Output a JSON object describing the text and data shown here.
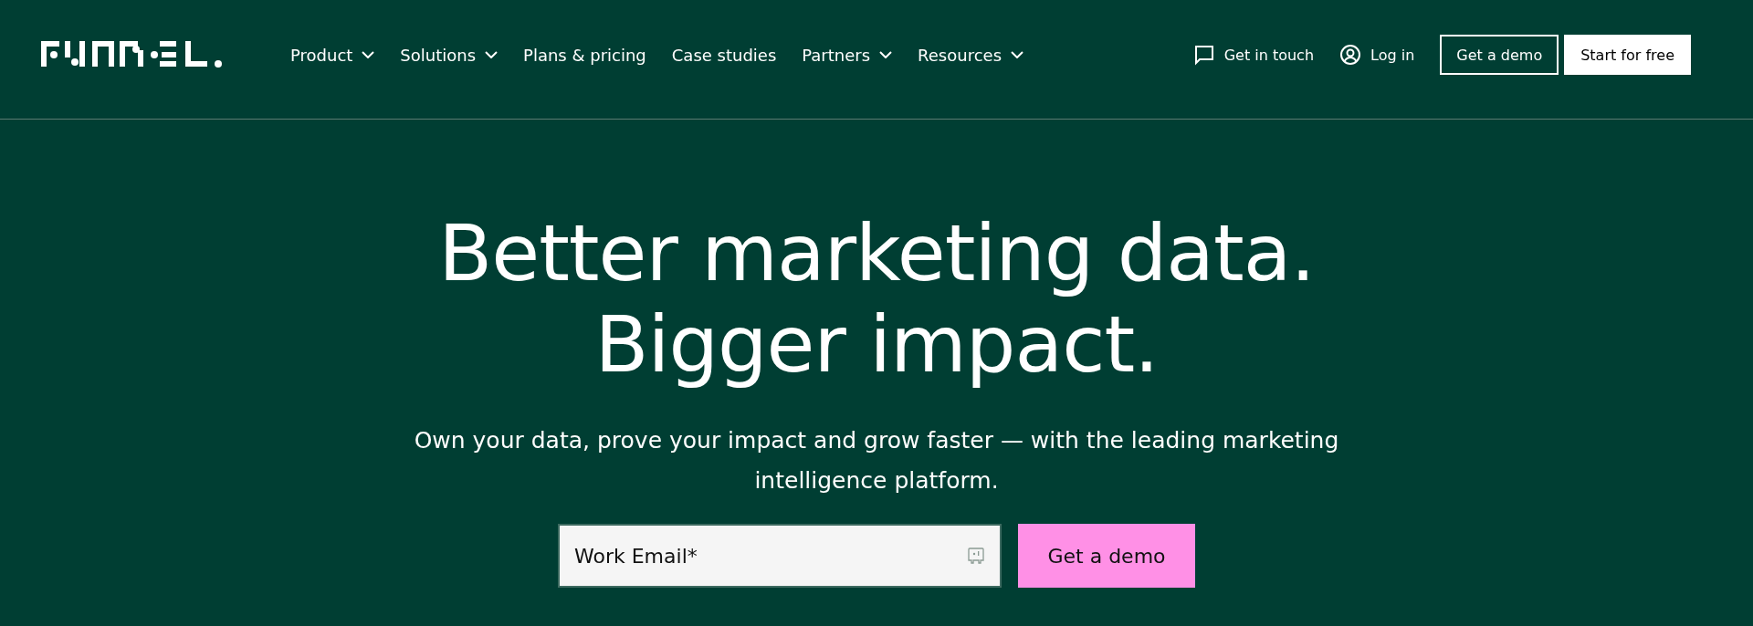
{
  "nav": {
    "items": [
      {
        "label": "Product",
        "dropdown": true
      },
      {
        "label": "Solutions",
        "dropdown": true
      },
      {
        "label": "Plans & pricing",
        "dropdown": false
      },
      {
        "label": "Case studies",
        "dropdown": false
      },
      {
        "label": "Partners",
        "dropdown": true
      },
      {
        "label": "Resources",
        "dropdown": true
      }
    ],
    "contact": "Get in touch",
    "login": "Log in",
    "demo_button": "Get a demo",
    "start_button": "Start for free"
  },
  "hero": {
    "headline": [
      "Better marketing data.",
      "Bigger impact."
    ],
    "subtitle": "Own your data, prove your impact and grow faster — with the leading marketing intelligence platform.",
    "email_field": {
      "placeholder": "Work Email*"
    },
    "submit_button": "Get a demo"
  }
}
